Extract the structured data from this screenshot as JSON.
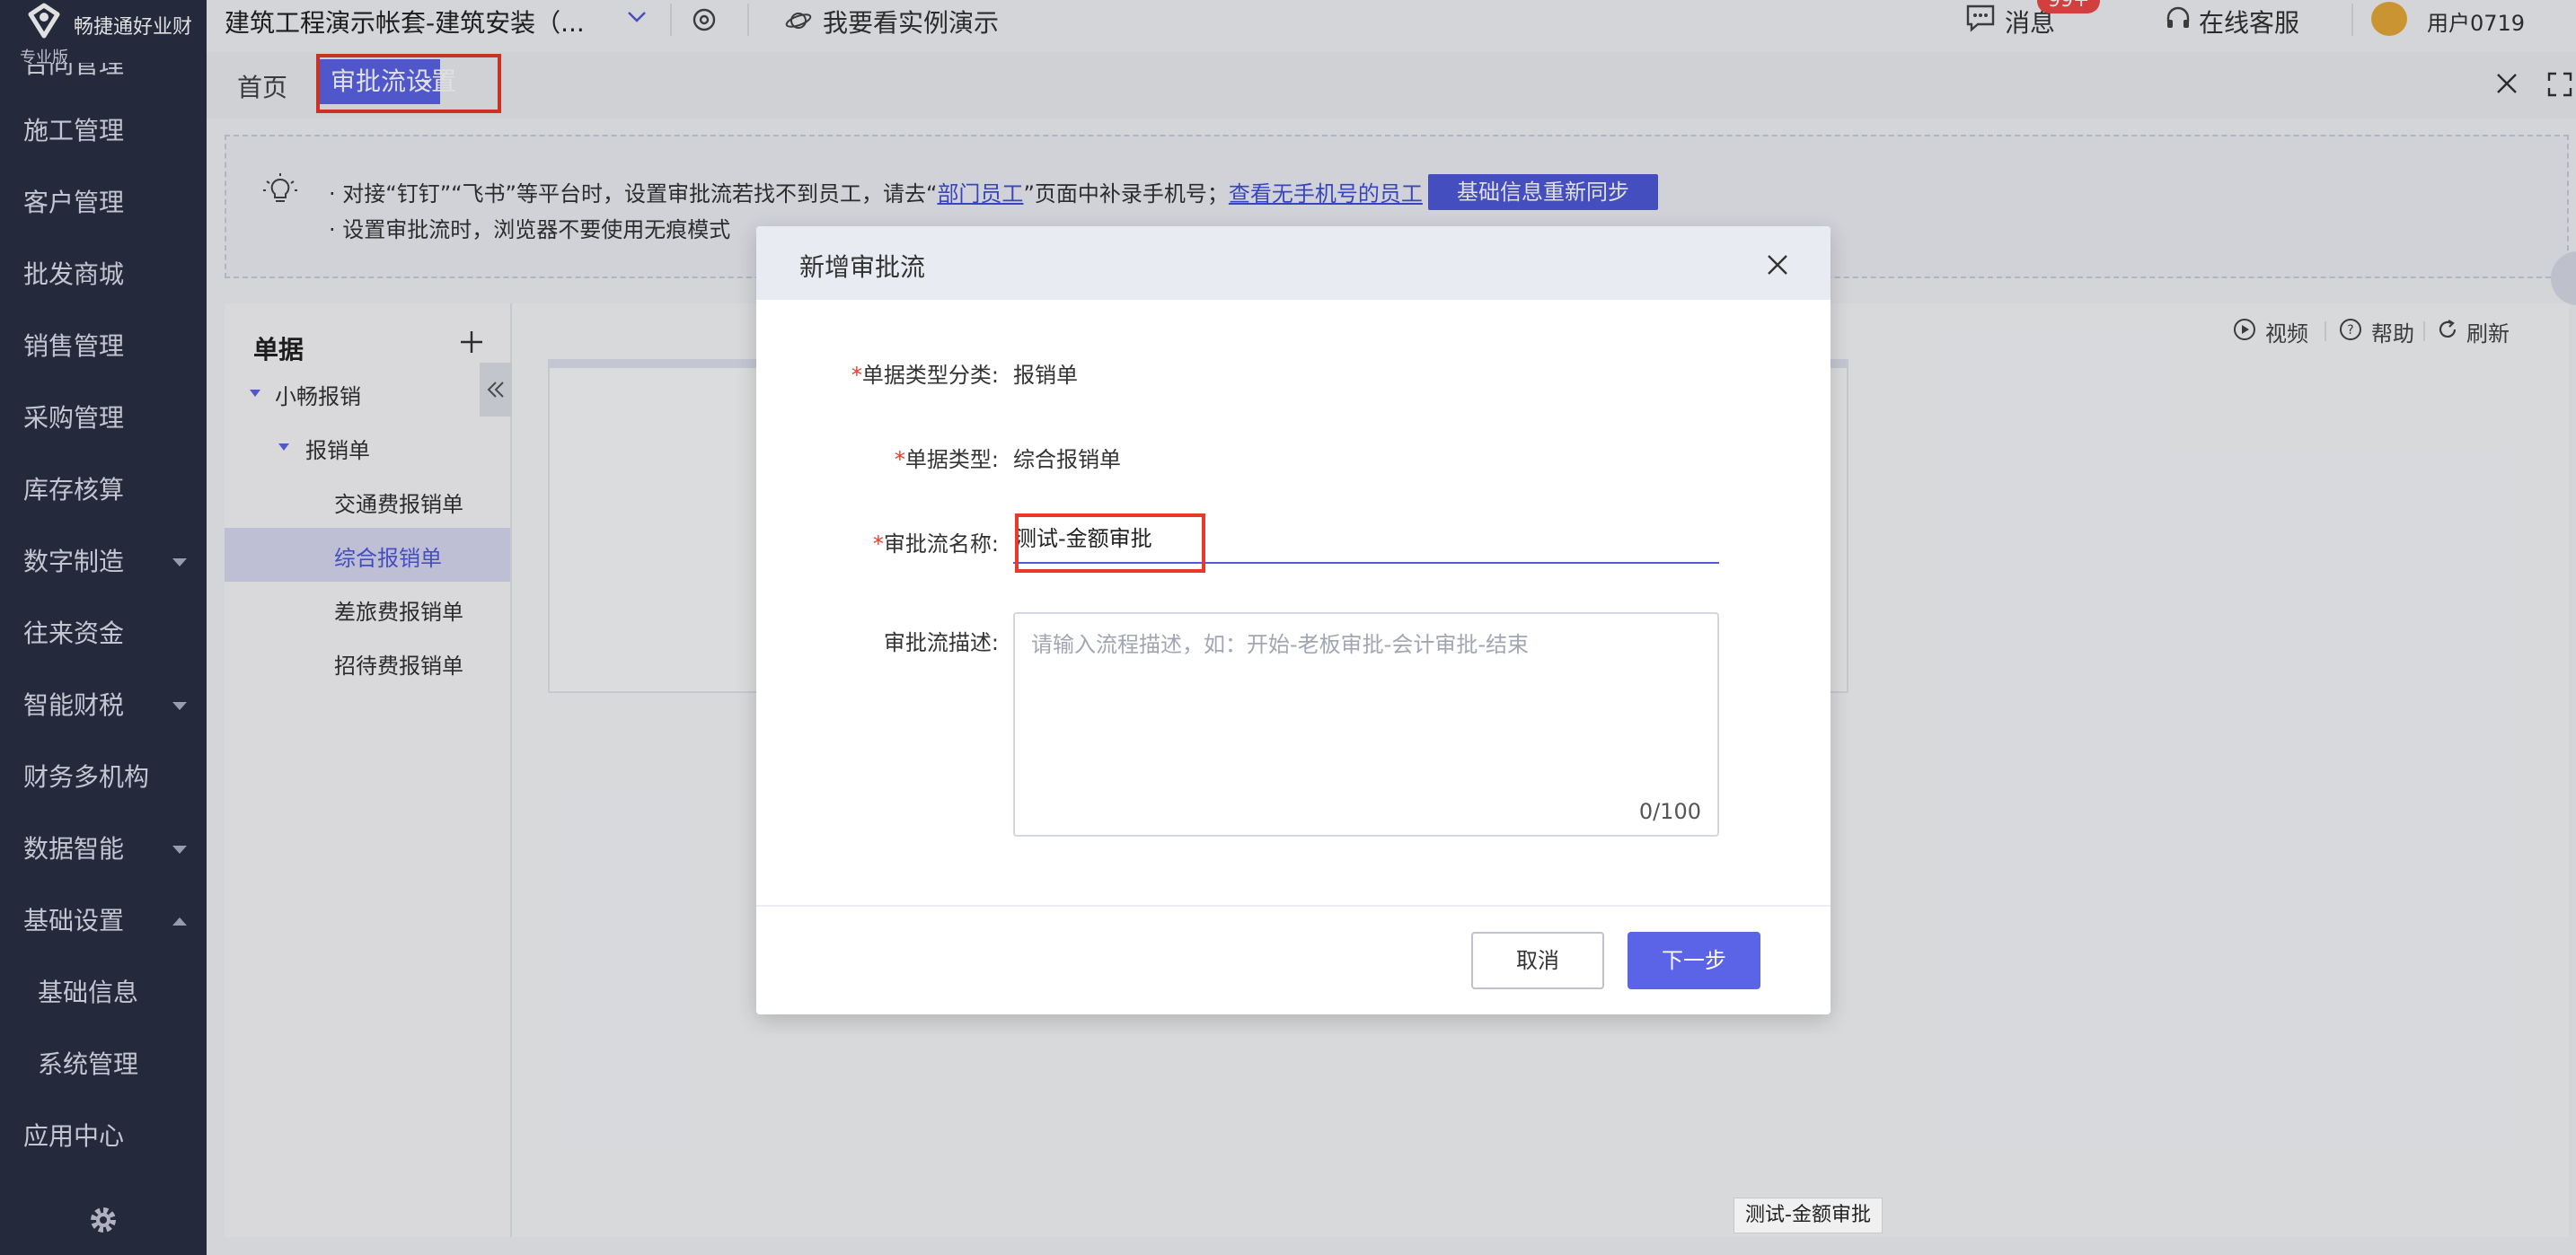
{
  "app": {
    "logo_text": "畅捷通好业财",
    "edition": "专业版",
    "account": "建筑工程演示帐套-建筑安装（...",
    "demo_link": "我要看实例演示",
    "messages_label": "消息",
    "messages_badge": "99+",
    "support_label": "在线客服",
    "user": "用户0719"
  },
  "sidebar": {
    "items": [
      {
        "label": "合同管理"
      },
      {
        "label": "施工管理"
      },
      {
        "label": "客户管理"
      },
      {
        "label": "批发商城"
      },
      {
        "label": "销售管理"
      },
      {
        "label": "采购管理"
      },
      {
        "label": "库存核算"
      },
      {
        "label": "数字制造"
      },
      {
        "label": "往来资金"
      },
      {
        "label": "智能财税"
      },
      {
        "label": "财务多机构"
      },
      {
        "label": "数据智能"
      },
      {
        "label": "基础设置"
      },
      {
        "label": "基础信息"
      },
      {
        "label": "系统管理"
      },
      {
        "label": "应用中心"
      }
    ]
  },
  "tabs": {
    "home": "首页",
    "active": "审批流设置"
  },
  "banner": {
    "line1_prefix": "· 对接“钉钉”“飞书”等平台时，设置审批流若找不到员工，请去“",
    "line1_link1": "部门员工",
    "line1_mid": "”页面中补录手机号；",
    "line1_link2": "查看无手机号的员工",
    "sync_button": "基础信息重新同步",
    "line2": "· 设置审批流时，浏览器不要使用无痕模式"
  },
  "tree": {
    "title": "单据",
    "root": "小畅报销",
    "child": "报销单",
    "leaves": [
      "交通费报销单",
      "综合报销单",
      "差旅费报销单",
      "招待费报销单"
    ],
    "selected": "综合报销单"
  },
  "toolbar": {
    "video": "视频",
    "help": "帮助",
    "refresh": "刷新"
  },
  "modal": {
    "title": "新增审批流",
    "fields": {
      "category_label": "单据类型分类:",
      "category_value": "报销单",
      "type_label": "单据类型:",
      "type_value": "综合报销单",
      "name_label": "审批流名称:",
      "name_value": "测试-金额审批",
      "desc_label": "审批流描述:",
      "desc_placeholder": "请输入流程描述，如：开始-老板审批-会计审批-结束",
      "desc_count": "0/100"
    },
    "required_mark": "*",
    "cancel": "取消",
    "next": "下一步"
  },
  "tooltip": "测试-金额审批",
  "colors": {
    "accent": "#5b63e6",
    "sidebar": "#2a2f45",
    "highlight_outline": "#e8392a",
    "badge": "#f04848"
  }
}
